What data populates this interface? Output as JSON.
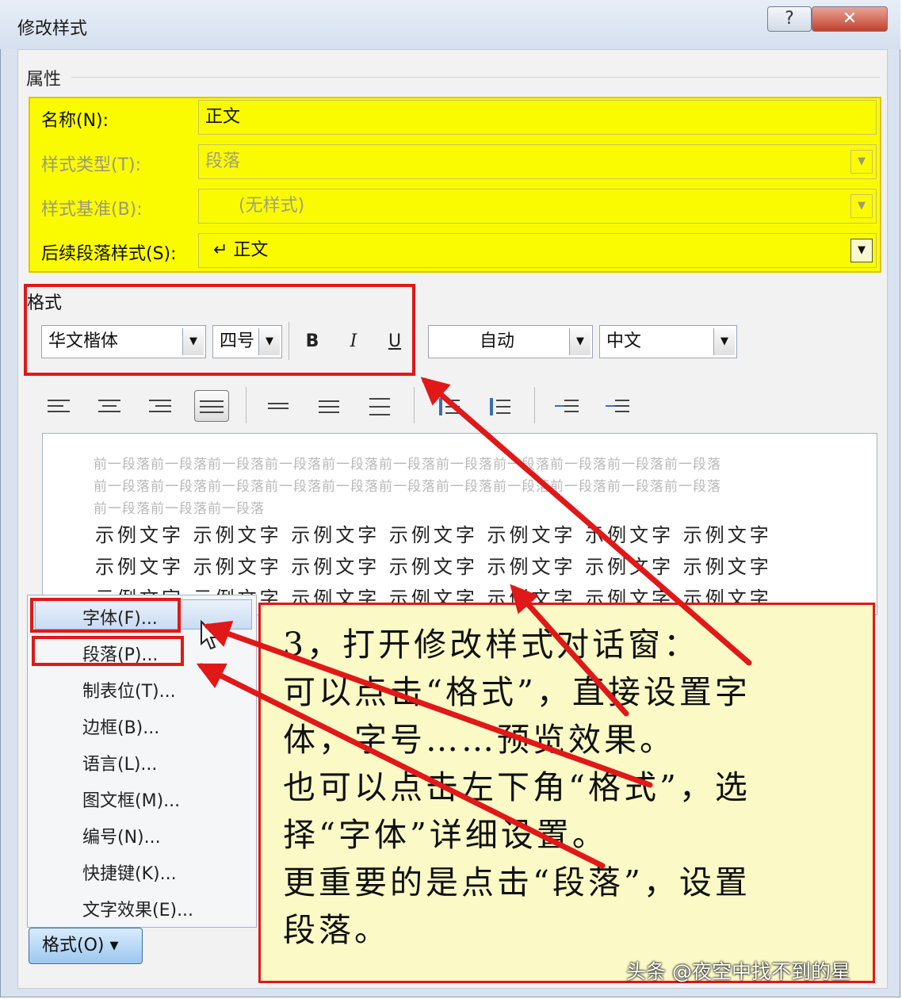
{
  "window": {
    "title": "修改样式",
    "help_glyph": "?",
    "close_glyph": "✕"
  },
  "properties": {
    "section_label": "属性",
    "name_label": "名称(N):",
    "name_value": "正文",
    "type_label": "样式类型(T):",
    "type_value": "段落",
    "based_label": "样式基准(B):",
    "based_value": "(无样式)",
    "next_label": "后续段落样式(S):",
    "next_value": "↵ 正文",
    "highlight_color": "#fbfb00"
  },
  "format": {
    "section_label": "格式",
    "font": "华文楷体",
    "size": "四号",
    "bold": "B",
    "italic": "I",
    "underline": "U",
    "color": "自动",
    "script": "中文"
  },
  "preview": {
    "prev_lines": [
      "前一段落前一段落前一段落前一段落前一段落前一段落前一段落前一段落前一段落前一段落前一段落",
      "前一段落前一段落前一段落前一段落前一段落前一段落前一段落前一段落前一段落前一段落前一段落",
      "前一段落前一段落前一段落"
    ],
    "sample_lines": [
      "示例文字 示例文字 示例文字 示例文字 示例文字 示例文字 示例文字",
      "示例文字 示例文字 示例文字 示例文字 示例文字 示例文字 示例文字",
      "示例文字 示例文字 示例文字 示例文字 示例文字 示例文字 示例文字"
    ]
  },
  "menu": {
    "items": [
      "字体(F)...",
      "段落(P)...",
      "制表位(T)...",
      "边框(B)...",
      "语言(L)...",
      "图文框(M)...",
      "编号(N)...",
      "快捷键(K)...",
      "文字效果(E)..."
    ],
    "button": "格式(O) ▾"
  },
  "note": {
    "lines": [
      "3，打开修改样式对话窗：",
      "可以点击“格式”，直接设置字",
      "体，字号……预览效果。",
      "也可以点击左下角“格式”，选",
      "择“字体”详细设置。",
      "更重要的是点击“段落”，设置",
      "段落。"
    ],
    "accent_color": "#e01818"
  },
  "watermark": "头条 @夜空中找不到的星"
}
